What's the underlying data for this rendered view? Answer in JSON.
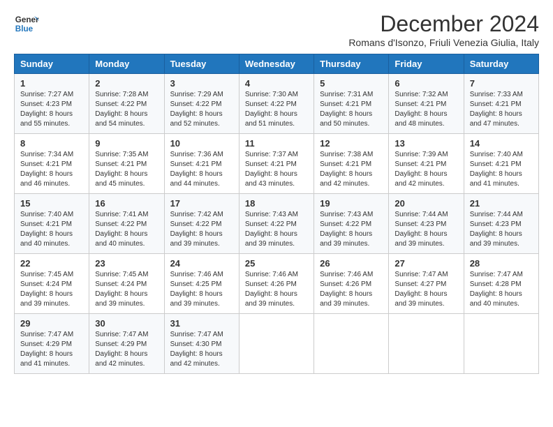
{
  "logo": {
    "line1": "General",
    "line2": "Blue"
  },
  "title": "December 2024",
  "subtitle": "Romans d'Isonzo, Friuli Venezia Giulia, Italy",
  "weekdays": [
    "Sunday",
    "Monday",
    "Tuesday",
    "Wednesday",
    "Thursday",
    "Friday",
    "Saturday"
  ],
  "weeks": [
    [
      {
        "day": "1",
        "sunrise": "7:27 AM",
        "sunset": "4:23 PM",
        "daylight": "8 hours and 55 minutes."
      },
      {
        "day": "2",
        "sunrise": "7:28 AM",
        "sunset": "4:22 PM",
        "daylight": "8 hours and 54 minutes."
      },
      {
        "day": "3",
        "sunrise": "7:29 AM",
        "sunset": "4:22 PM",
        "daylight": "8 hours and 52 minutes."
      },
      {
        "day": "4",
        "sunrise": "7:30 AM",
        "sunset": "4:22 PM",
        "daylight": "8 hours and 51 minutes."
      },
      {
        "day": "5",
        "sunrise": "7:31 AM",
        "sunset": "4:21 PM",
        "daylight": "8 hours and 50 minutes."
      },
      {
        "day": "6",
        "sunrise": "7:32 AM",
        "sunset": "4:21 PM",
        "daylight": "8 hours and 48 minutes."
      },
      {
        "day": "7",
        "sunrise": "7:33 AM",
        "sunset": "4:21 PM",
        "daylight": "8 hours and 47 minutes."
      }
    ],
    [
      {
        "day": "8",
        "sunrise": "7:34 AM",
        "sunset": "4:21 PM",
        "daylight": "8 hours and 46 minutes."
      },
      {
        "day": "9",
        "sunrise": "7:35 AM",
        "sunset": "4:21 PM",
        "daylight": "8 hours and 45 minutes."
      },
      {
        "day": "10",
        "sunrise": "7:36 AM",
        "sunset": "4:21 PM",
        "daylight": "8 hours and 44 minutes."
      },
      {
        "day": "11",
        "sunrise": "7:37 AM",
        "sunset": "4:21 PM",
        "daylight": "8 hours and 43 minutes."
      },
      {
        "day": "12",
        "sunrise": "7:38 AM",
        "sunset": "4:21 PM",
        "daylight": "8 hours and 42 minutes."
      },
      {
        "day": "13",
        "sunrise": "7:39 AM",
        "sunset": "4:21 PM",
        "daylight": "8 hours and 42 minutes."
      },
      {
        "day": "14",
        "sunrise": "7:40 AM",
        "sunset": "4:21 PM",
        "daylight": "8 hours and 41 minutes."
      }
    ],
    [
      {
        "day": "15",
        "sunrise": "7:40 AM",
        "sunset": "4:21 PM",
        "daylight": "8 hours and 40 minutes."
      },
      {
        "day": "16",
        "sunrise": "7:41 AM",
        "sunset": "4:22 PM",
        "daylight": "8 hours and 40 minutes."
      },
      {
        "day": "17",
        "sunrise": "7:42 AM",
        "sunset": "4:22 PM",
        "daylight": "8 hours and 39 minutes."
      },
      {
        "day": "18",
        "sunrise": "7:43 AM",
        "sunset": "4:22 PM",
        "daylight": "8 hours and 39 minutes."
      },
      {
        "day": "19",
        "sunrise": "7:43 AM",
        "sunset": "4:22 PM",
        "daylight": "8 hours and 39 minutes."
      },
      {
        "day": "20",
        "sunrise": "7:44 AM",
        "sunset": "4:23 PM",
        "daylight": "8 hours and 39 minutes."
      },
      {
        "day": "21",
        "sunrise": "7:44 AM",
        "sunset": "4:23 PM",
        "daylight": "8 hours and 39 minutes."
      }
    ],
    [
      {
        "day": "22",
        "sunrise": "7:45 AM",
        "sunset": "4:24 PM",
        "daylight": "8 hours and 39 minutes."
      },
      {
        "day": "23",
        "sunrise": "7:45 AM",
        "sunset": "4:24 PM",
        "daylight": "8 hours and 39 minutes."
      },
      {
        "day": "24",
        "sunrise": "7:46 AM",
        "sunset": "4:25 PM",
        "daylight": "8 hours and 39 minutes."
      },
      {
        "day": "25",
        "sunrise": "7:46 AM",
        "sunset": "4:26 PM",
        "daylight": "8 hours and 39 minutes."
      },
      {
        "day": "26",
        "sunrise": "7:46 AM",
        "sunset": "4:26 PM",
        "daylight": "8 hours and 39 minutes."
      },
      {
        "day": "27",
        "sunrise": "7:47 AM",
        "sunset": "4:27 PM",
        "daylight": "8 hours and 39 minutes."
      },
      {
        "day": "28",
        "sunrise": "7:47 AM",
        "sunset": "4:28 PM",
        "daylight": "8 hours and 40 minutes."
      }
    ],
    [
      {
        "day": "29",
        "sunrise": "7:47 AM",
        "sunset": "4:29 PM",
        "daylight": "8 hours and 41 minutes."
      },
      {
        "day": "30",
        "sunrise": "7:47 AM",
        "sunset": "4:29 PM",
        "daylight": "8 hours and 42 minutes."
      },
      {
        "day": "31",
        "sunrise": "7:47 AM",
        "sunset": "4:30 PM",
        "daylight": "8 hours and 42 minutes."
      },
      null,
      null,
      null,
      null
    ]
  ],
  "labels": {
    "sunrise": "Sunrise:",
    "sunset": "Sunset:",
    "daylight": "Daylight:"
  }
}
